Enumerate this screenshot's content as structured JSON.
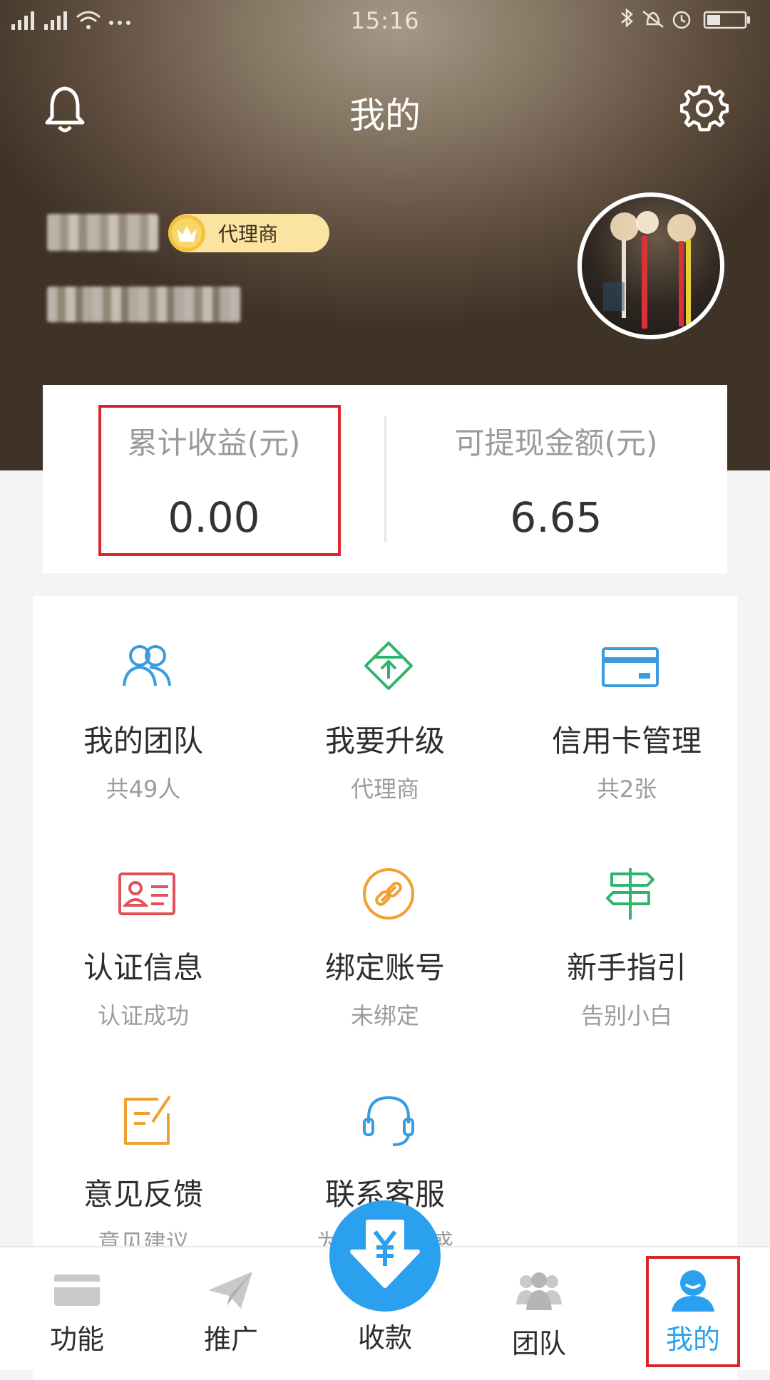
{
  "status_bar": {
    "time": "15:16"
  },
  "header": {
    "title": "我的"
  },
  "profile": {
    "badge_label": "代理商"
  },
  "summary": {
    "cumulative_label": "累计收益(元)",
    "cumulative_value": "0.00",
    "withdrawable_label": "可提现金额(元)",
    "withdrawable_value": "6.65"
  },
  "features": [
    {
      "title": "我的团队",
      "subtitle": "共49人",
      "icon": "team-icon",
      "color": "#3a9be0"
    },
    {
      "title": "我要升级",
      "subtitle": "代理商",
      "icon": "upgrade-icon",
      "color": "#2fb46b"
    },
    {
      "title": "信用卡管理",
      "subtitle": "共2张",
      "icon": "credit-card-icon",
      "color": "#3a9be0"
    },
    {
      "title": "认证信息",
      "subtitle": "认证成功",
      "icon": "id-card-icon",
      "color": "#e0525a"
    },
    {
      "title": "绑定账号",
      "subtitle": "未绑定",
      "icon": "link-icon",
      "color": "#f0a030"
    },
    {
      "title": "新手指引",
      "subtitle": "告别小白",
      "icon": "signpost-icon",
      "color": "#2fb46b"
    },
    {
      "title": "意见反馈",
      "subtitle": "意见建议",
      "icon": "feedback-icon",
      "color": "#f0a030"
    },
    {
      "title": "联系客服",
      "subtitle": "为您答疑解惑",
      "icon": "headset-icon",
      "color": "#3a9be0"
    }
  ],
  "tabbar": {
    "tabs": [
      {
        "label": "功能",
        "icon": "card-icon"
      },
      {
        "label": "推广",
        "icon": "paper-plane-icon"
      },
      {
        "label": "收款",
        "icon": "yen-download-icon"
      },
      {
        "label": "团队",
        "icon": "group-icon"
      },
      {
        "label": "我的",
        "icon": "person-icon"
      }
    ],
    "active_tab": "我的",
    "active_color": "#2aa0ee"
  },
  "colors": {
    "accent": "#2aa0ee",
    "highlight_box": "#d9262b",
    "badge_bg": "#fbe3a0"
  }
}
